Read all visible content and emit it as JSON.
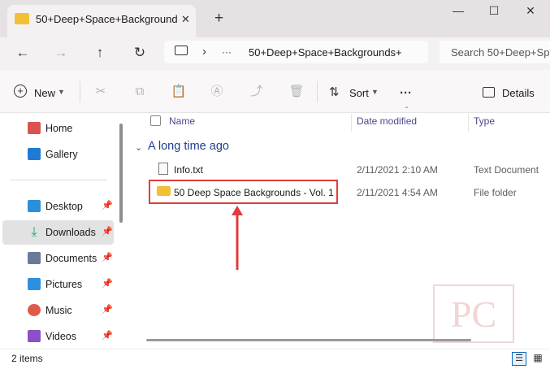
{
  "window": {
    "tab_title": "50+Deep+Space+Background",
    "new_tab_symbol": "+",
    "close_tab_symbol": "✕"
  },
  "navigation": {
    "breadcrumb_more": "···",
    "breadcrumb_separator": "›",
    "breadcrumb_current": "50+Deep+Space+Backgrounds+",
    "search_placeholder": "Search 50+Deep+Sp"
  },
  "commandbar": {
    "new_label": "New",
    "sort_label": "Sort",
    "more_label": "···",
    "details_label": "Details"
  },
  "sidebar": {
    "items": [
      {
        "label": "Home",
        "icon": "home-icon",
        "color": "#d9534f"
      },
      {
        "label": "Gallery",
        "icon": "gallery-icon",
        "color": "#1f7ad6"
      },
      {
        "label": "Desktop",
        "icon": "desktop-icon",
        "color": "#2b8fd9"
      },
      {
        "label": "Downloads",
        "icon": "download-icon",
        "color": "#1aa36b"
      },
      {
        "label": "Documents",
        "icon": "documents-icon",
        "color": "#6b7a99"
      },
      {
        "label": "Pictures",
        "icon": "pictures-icon",
        "color": "#2d8fe0"
      },
      {
        "label": "Music",
        "icon": "music-icon",
        "color": "#e0584a"
      },
      {
        "label": "Videos",
        "icon": "videos-icon",
        "color": "#8a4fc9"
      }
    ]
  },
  "columns": {
    "name": "Name",
    "date_modified": "Date modified",
    "type": "Type"
  },
  "group": {
    "label": "A long time ago"
  },
  "files": [
    {
      "name": "Info.txt",
      "date": "2/11/2021 2:10 AM",
      "type": "Text Document"
    },
    {
      "name": "50 Deep Space Backgrounds - Vol. 1",
      "date": "2/11/2021 4:54 AM",
      "type": "File folder"
    }
  ],
  "status": {
    "item_count": "2 items"
  },
  "colors": {
    "accent": "#0067c0",
    "highlight": "#e23b3b",
    "folder": "#f2c037"
  },
  "watermark": {
    "brand": "PC"
  }
}
